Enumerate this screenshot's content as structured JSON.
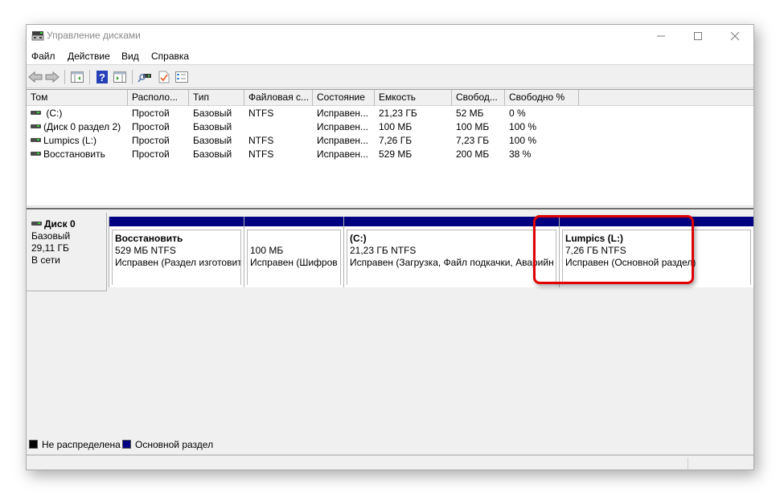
{
  "window": {
    "title": "Управление дисками",
    "controls": {
      "minimize": "—",
      "maximize": "☐",
      "close": "✕"
    }
  },
  "menu": [
    "Файл",
    "Действие",
    "Вид",
    "Справка"
  ],
  "toolbar": {
    "buttons": [
      "back-icon",
      "forward-icon",
      "console-tree-icon",
      "help-icon",
      "action-pane-icon",
      "rescan-disks-icon",
      "properties-icon",
      "checklist-icon"
    ]
  },
  "volume_list": {
    "columns": [
      "Том",
      "Располо...",
      "Тип",
      "Файловая с...",
      "Состояние",
      "Емкость",
      "Свобод...",
      "Свободно %"
    ],
    "rows": [
      {
        "volume": " (C:)",
        "layout": "Простой",
        "type": "Базовый",
        "fs": "NTFS",
        "status": "Исправен...",
        "capacity": "21,23 ГБ",
        "free": "52 МБ",
        "free_pct": "0 %"
      },
      {
        "volume": "(Диск 0 раздел 2)",
        "layout": "Простой",
        "type": "Базовый",
        "fs": "",
        "status": "Исправен...",
        "capacity": "100 МБ",
        "free": "100 МБ",
        "free_pct": "100 %"
      },
      {
        "volume": "Lumpics (L:)",
        "layout": "Простой",
        "type": "Базовый",
        "fs": "NTFS",
        "status": "Исправен...",
        "capacity": "7,26 ГБ",
        "free": "7,23 ГБ",
        "free_pct": "100 %"
      },
      {
        "volume": "Восстановить",
        "layout": "Простой",
        "type": "Базовый",
        "fs": "NTFS",
        "status": "Исправен...",
        "capacity": "529 МБ",
        "free": "200 МБ",
        "free_pct": "38 %"
      }
    ]
  },
  "disk": {
    "name": "Диск 0",
    "type": "Базовый",
    "size": "29,11 ГБ",
    "status": "В сети",
    "partitions": [
      {
        "title": "Восстановить",
        "line2": "529 МБ NTFS",
        "line3": "Исправен (Раздел изготовит"
      },
      {
        "title": "",
        "line2": "100 МБ",
        "line3": "Исправен (Шифров"
      },
      {
        "title": " (C:)",
        "line2": "21,23 ГБ NTFS",
        "line3": "Исправен (Загрузка, Файл подкачки, Аварийн"
      },
      {
        "title": "Lumpics  (L:)",
        "line2": "7,26 ГБ NTFS",
        "line3": "Исправен (Основной раздел)",
        "highlighted": true
      }
    ]
  },
  "legend": [
    {
      "label": "Не распределена",
      "color": "#000000"
    },
    {
      "label": "Основной раздел",
      "color": "#000080"
    }
  ],
  "colors": {
    "primary_partition": "#000080",
    "unallocated": "#000000",
    "highlight": "#e00000"
  }
}
